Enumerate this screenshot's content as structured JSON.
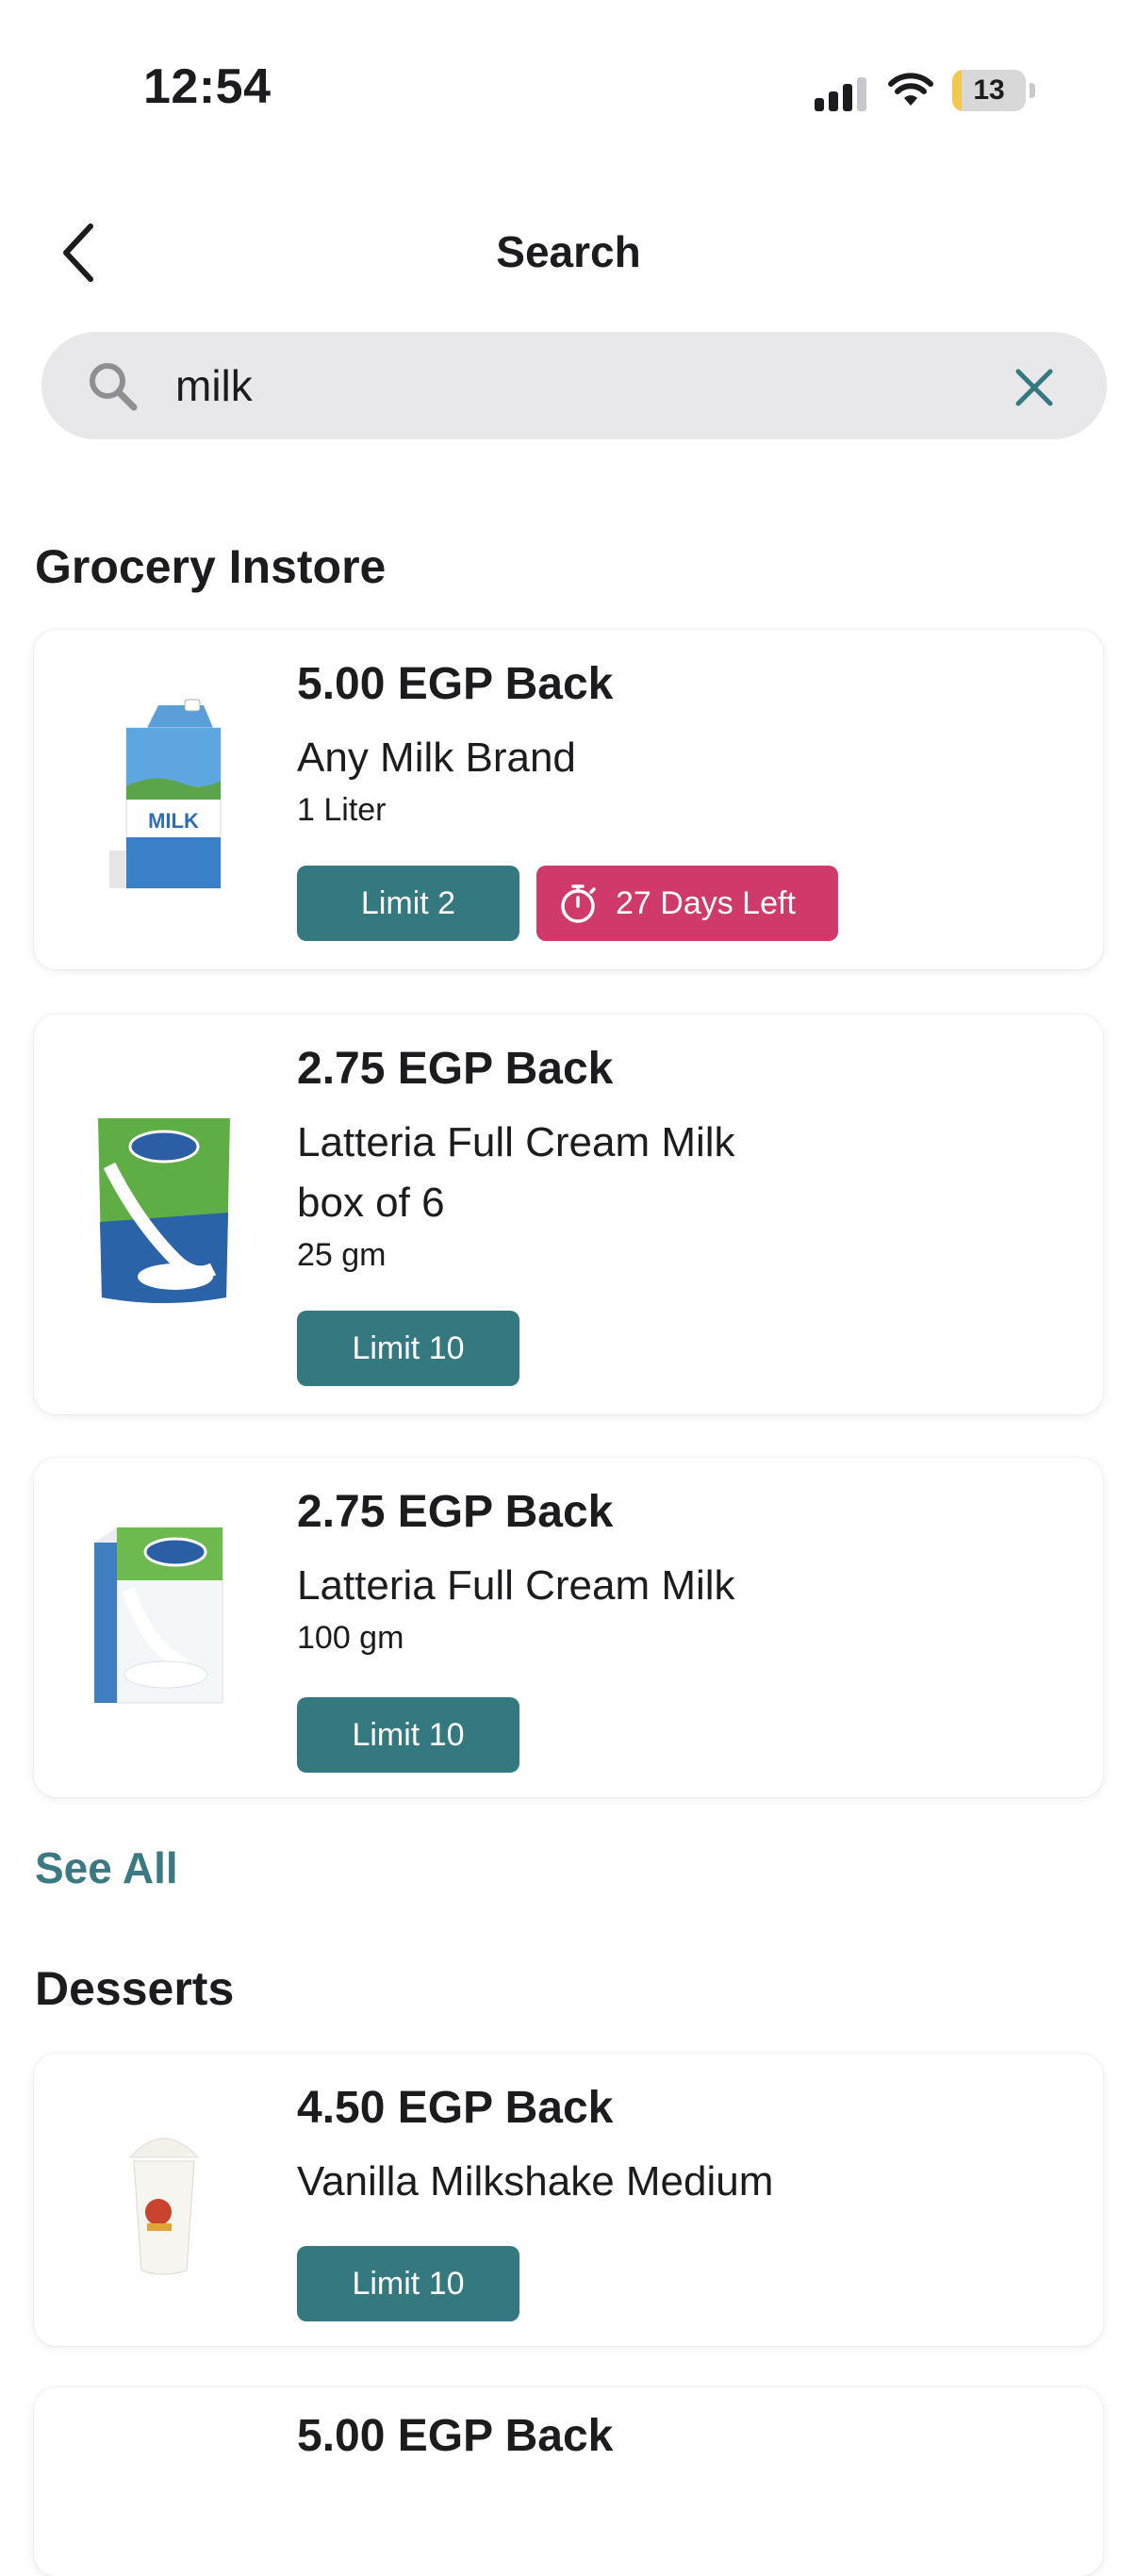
{
  "status_bar": {
    "time": "12:54",
    "battery_level": "13",
    "battery_fraction": 0.13,
    "icons": [
      "cellular-signal-icon",
      "wifi-icon",
      "battery-icon"
    ]
  },
  "header": {
    "title": "Search",
    "back_icon": "chevron-left-icon"
  },
  "search": {
    "value": "milk",
    "placeholder": "",
    "icon": "search-icon",
    "clear_icon": "close-icon"
  },
  "colors": {
    "accent": "#357980",
    "link": "#3b7a82",
    "deadline_tag": "#cf3a6a",
    "search_bg": "#e8e8ea"
  },
  "sections": [
    {
      "title": "Grocery Instore",
      "see_all": "See All",
      "items": [
        {
          "cashback": "5.00 EGP Back",
          "name": "Any Milk Brand",
          "size": "1 Liter",
          "limit": "Limit 2",
          "days_left": "27  Days Left",
          "image": "milk-carton-image"
        },
        {
          "cashback": "2.75 EGP Back",
          "name": "Latteria Full Cream Milk box of 6",
          "size": "25 gm",
          "limit": "Limit 10",
          "image": "milk-powder-pouch-image"
        },
        {
          "cashback": "2.75 EGP Back",
          "name": "Latteria Full Cream Milk",
          "size": "100 gm",
          "limit": "Limit 10",
          "image": "milk-powder-box-image"
        }
      ]
    },
    {
      "title": "Desserts",
      "items": [
        {
          "cashback": "4.50 EGP Back",
          "name": "Vanilla Milkshake Medium",
          "limit": "Limit 10",
          "image": "milkshake-cup-image"
        },
        {
          "cashback": "5.00 EGP Back"
        }
      ]
    }
  ]
}
